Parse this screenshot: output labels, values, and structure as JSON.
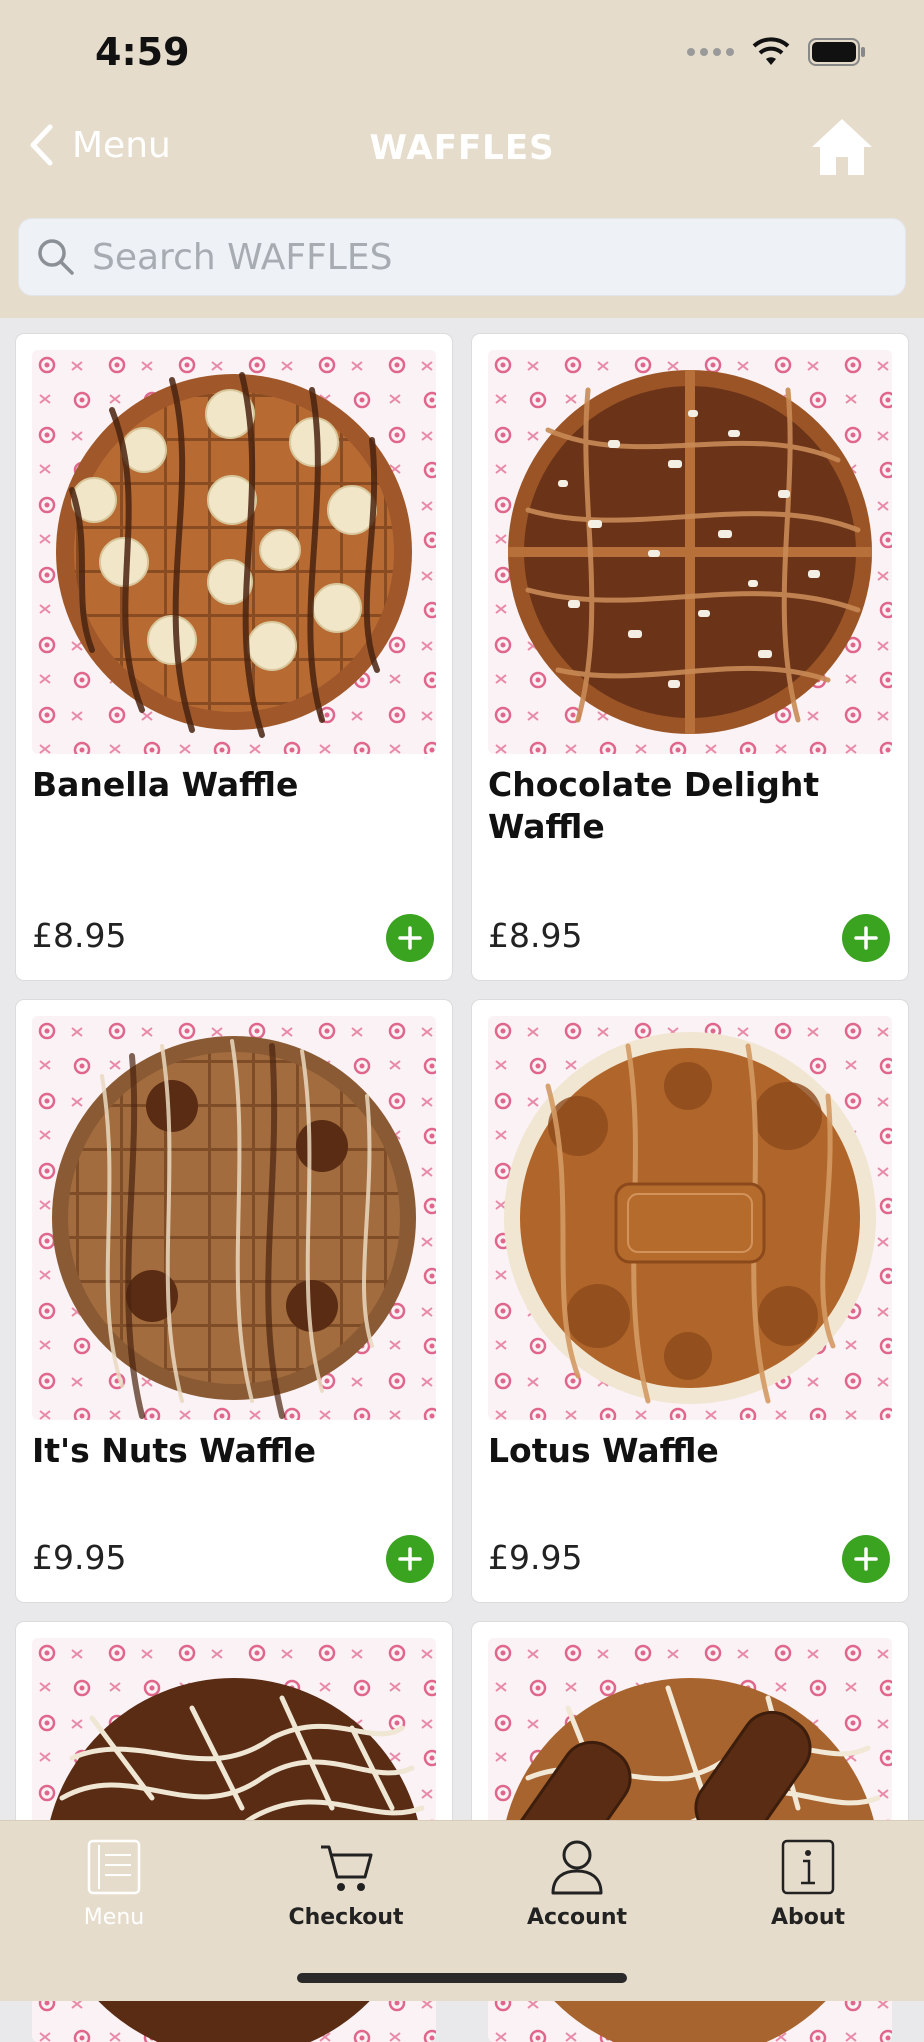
{
  "status": {
    "time": "4:59"
  },
  "nav": {
    "back_label": "Menu",
    "title": "WAFFLES"
  },
  "search": {
    "placeholder": "Search WAFFLES"
  },
  "products": [
    {
      "name": "Banella Waffle",
      "price": "£8.95"
    },
    {
      "name": "Chocolate Delight Waffle",
      "price": "£8.95"
    },
    {
      "name": "It's Nuts Waffle",
      "price": "£9.95"
    },
    {
      "name": "Lotus Waffle",
      "price": "£9.95"
    }
  ],
  "tabs": [
    {
      "label": "Menu",
      "icon": "menu-book-icon",
      "active": true
    },
    {
      "label": "Checkout",
      "icon": "cart-icon",
      "active": false
    },
    {
      "label": "Account",
      "icon": "person-icon",
      "active": false
    },
    {
      "label": "About",
      "icon": "info-icon",
      "active": false
    }
  ],
  "colors": {
    "header_bg": "#e6dccb",
    "page_bg": "#e9e8ea",
    "add_button": "#3aa31f",
    "paper_pink": "#e0668c"
  }
}
